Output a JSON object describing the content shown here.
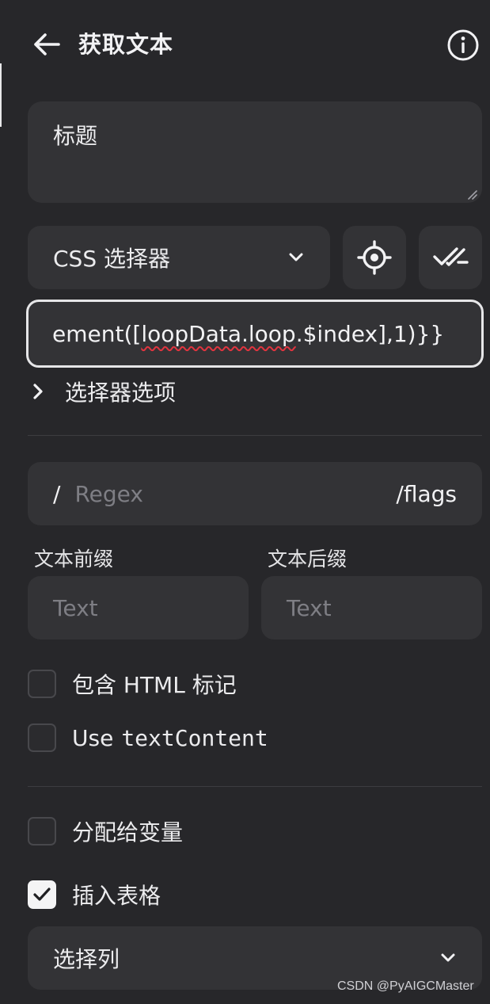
{
  "header": {
    "title": "获取文本",
    "back_icon": "arrow-left-icon",
    "info_icon": "info-circle-icon"
  },
  "title_field": {
    "value": "标题"
  },
  "selector": {
    "type_label": "CSS 选择器",
    "dropdown_icon": "chevron-down-icon",
    "pick_icon": "crosshair-icon",
    "verify_icon": "double-check-icon",
    "input_value_prefix": "ement([",
    "input_value_squiggle": "loopData.loop",
    "input_value_suffix": ".$index],1)}}",
    "options_label": "选择器选项"
  },
  "regex": {
    "slash": "/",
    "placeholder": "Regex",
    "flags": "/flags"
  },
  "prefix": {
    "label": "文本前缀",
    "placeholder": "Text"
  },
  "suffix": {
    "label": "文本后缀",
    "placeholder": "Text"
  },
  "checkboxes": {
    "include_html": {
      "label": "包含 HTML 标记",
      "checked": false
    },
    "use_text_content": {
      "label": "Use",
      "code": "textContent",
      "checked": false
    },
    "assign_variable": {
      "label": "分配给变量",
      "checked": false
    },
    "insert_table": {
      "label": "插入表格",
      "checked": true
    }
  },
  "column_select": {
    "label": "选择列"
  },
  "watermark": "CSDN @PyAIGCMaster",
  "colors": {
    "background": "#27272a",
    "surface": "#333336",
    "text": "#ececee",
    "placeholder": "#7e7e84",
    "spellcheck": "#e0343f"
  }
}
